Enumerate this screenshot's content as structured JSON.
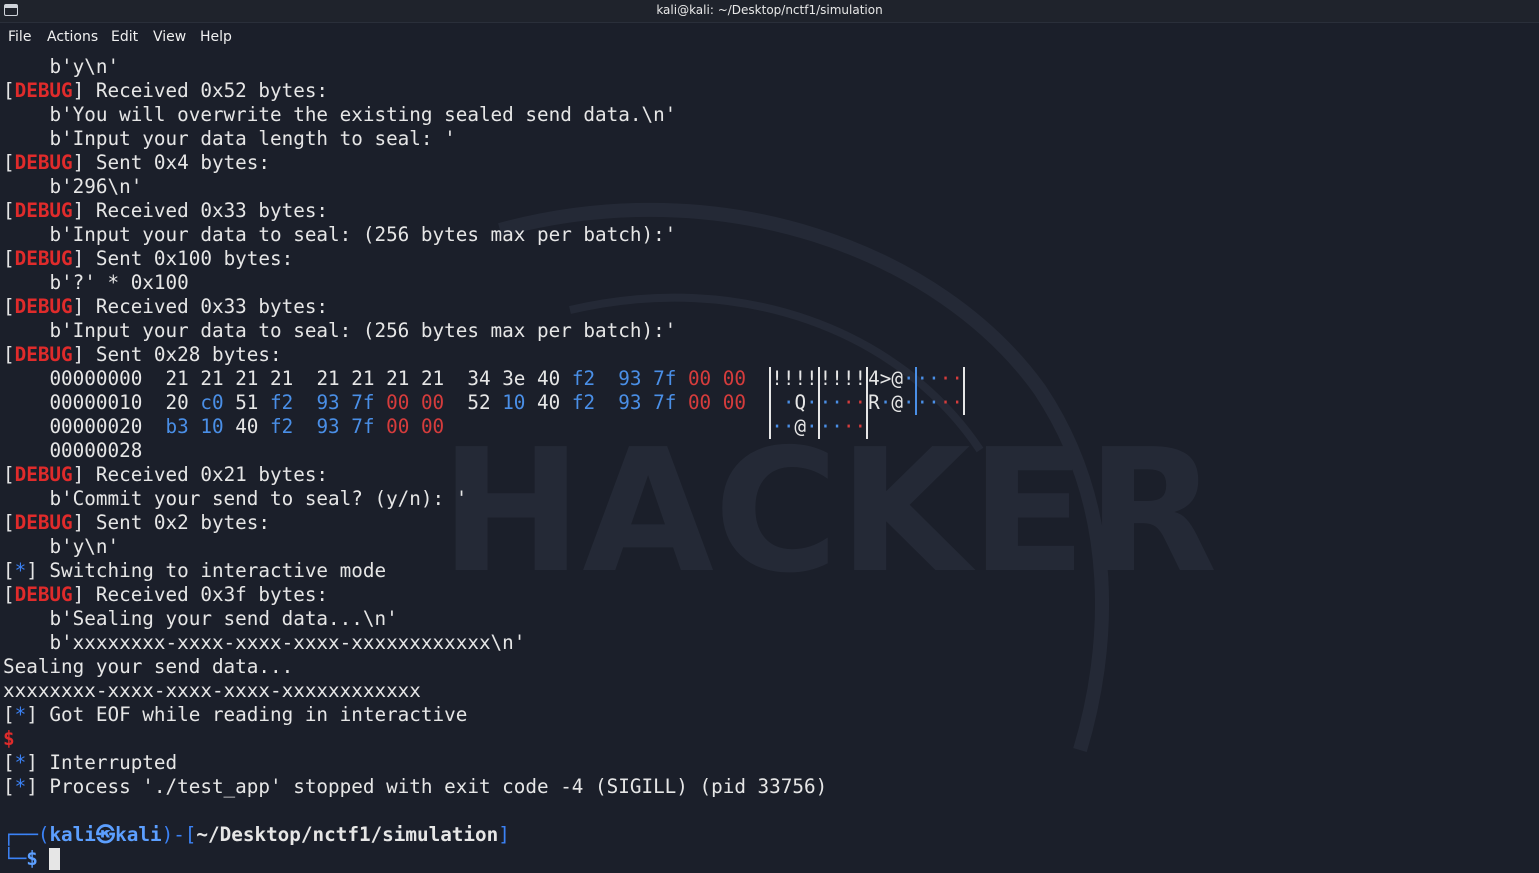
{
  "window": {
    "title": "kali@kali: ~/Desktop/nctf1/simulation"
  },
  "menu": [
    "File",
    "Actions",
    "Edit",
    "View",
    "Help"
  ],
  "colors": {
    "debug": "#e02b2b",
    "accent": "#3b82f6",
    "background": "#1b1f2a"
  },
  "lines": [
    {
      "indent": "    ",
      "text": "b'y\\n'"
    },
    {
      "tag": "DEBUG",
      "text": " Received 0x52 bytes:"
    },
    {
      "indent": "    ",
      "text": "b'You will overwrite the existing sealed send data.\\n'"
    },
    {
      "indent": "    ",
      "text": "b'Input your data length to seal: '"
    },
    {
      "tag": "DEBUG",
      "text": " Sent 0x4 bytes:"
    },
    {
      "indent": "    ",
      "text": "b'296\\n'"
    },
    {
      "tag": "DEBUG",
      "text": " Received 0x33 bytes:"
    },
    {
      "indent": "    ",
      "text": "b'Input your data to seal: (256 bytes max per batch):'"
    },
    {
      "tag": "DEBUG",
      "text": " Sent 0x100 bytes:"
    },
    {
      "indent": "    ",
      "text": "b'?' * 0x100"
    },
    {
      "tag": "DEBUG",
      "text": " Received 0x33 bytes:"
    },
    {
      "indent": "    ",
      "text": "b'Input your data to seal: (256 bytes max per batch):'"
    },
    {
      "tag": "DEBUG",
      "text": " Sent 0x28 bytes:"
    }
  ],
  "hexdump": [
    {
      "offset": "00000000",
      "groups": [
        [
          "21",
          "21",
          "21",
          "21"
        ],
        [
          "21",
          "21",
          "21",
          "21"
        ],
        [
          "34",
          "3e",
          "40",
          "f2"
        ],
        [
          "93",
          "7f",
          "00",
          "00"
        ]
      ],
      "ascii": [
        [
          "!",
          "!",
          "!",
          "!"
        ],
        [
          "!",
          "!",
          "!",
          "!"
        ],
        [
          "4",
          ">",
          "@",
          "·"
        ],
        [
          "·",
          "·",
          "·",
          "·"
        ]
      ]
    },
    {
      "offset": "00000010",
      "groups": [
        [
          "20",
          "c0",
          "51",
          "f2"
        ],
        [
          "93",
          "7f",
          "00",
          "00"
        ],
        [
          "52",
          "10",
          "40",
          "f2"
        ],
        [
          "93",
          "7f",
          "00",
          "00"
        ]
      ],
      "ascii": [
        [
          " ",
          "·",
          "Q",
          "·"
        ],
        [
          "·",
          "·",
          "·",
          "·"
        ],
        [
          "R",
          "·",
          "@",
          "·"
        ],
        [
          "·",
          "·",
          "·",
          "·"
        ]
      ]
    },
    {
      "offset": "00000020",
      "groups": [
        [
          "b3",
          "10",
          "40",
          "f2"
        ],
        [
          "93",
          "7f",
          "00",
          "00"
        ]
      ],
      "ascii": [
        [
          "·",
          "·",
          "@",
          "·"
        ],
        [
          "·",
          "·",
          "·",
          "·"
        ]
      ]
    },
    {
      "offset": "00000028",
      "groups": [],
      "ascii": []
    }
  ],
  "lines2": [
    {
      "tag": "DEBUG",
      "text": " Received 0x21 bytes:"
    },
    {
      "indent": "    ",
      "text": "b'Commit your send to seal? (y/n): '"
    },
    {
      "tag": "DEBUG",
      "text": " Sent 0x2 bytes:"
    },
    {
      "indent": "    ",
      "text": "b'y\\n'"
    },
    {
      "tag": "*",
      "text": " Switching to interactive mode"
    },
    {
      "tag": "DEBUG",
      "text": " Received 0x3f bytes:"
    },
    {
      "indent": "    ",
      "text": "b'Sealing your send data...\\n'"
    },
    {
      "indent": "    ",
      "text": "b'xxxxxxxx-xxxx-xxxx-xxxx-xxxxxxxxxxxx\\n'"
    },
    {
      "text": "Sealing your send data..."
    },
    {
      "text": "xxxxxxxx-xxxx-xxxx-xxxx-xxxxxxxxxxxx"
    },
    {
      "tag": "*",
      "text": " Got EOF while reading in interactive"
    },
    {
      "dollar": "$"
    },
    {
      "tag": "*",
      "text": " Interrupted"
    },
    {
      "tag": "*",
      "text": " Process './test_app' stopped with exit code -4 (SIGILL) (pid 33756)"
    },
    {
      "text": ""
    }
  ],
  "prompt": {
    "user": "kali",
    "sep": "㉿",
    "host": "kali",
    "path": "~/Desktop/nctf1/simulation",
    "symbol": "$"
  }
}
